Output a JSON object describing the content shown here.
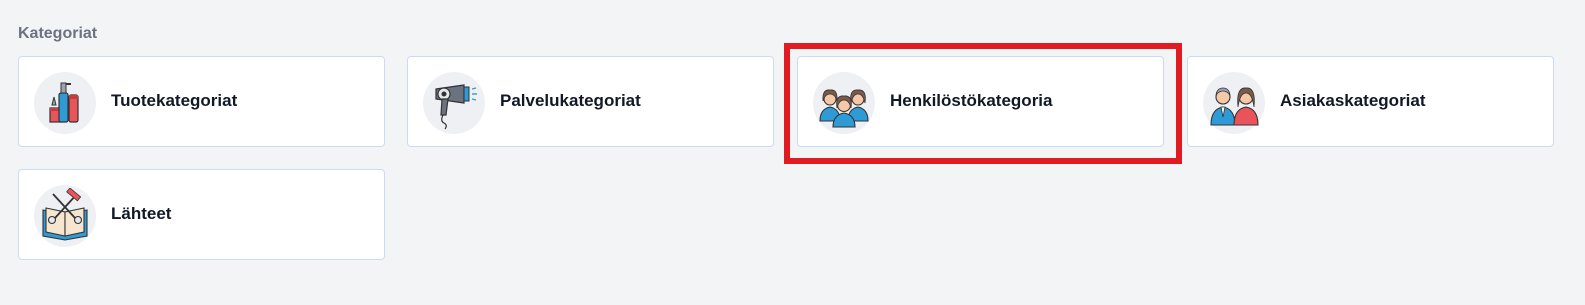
{
  "section": {
    "title": "Kategoriat"
  },
  "cards": [
    {
      "label": "Tuotekategoriat",
      "icon": "cosmetics-bottles-icon"
    },
    {
      "label": "Palvelukategoriat",
      "icon": "hair-dryer-icon"
    },
    {
      "label": "Henkilöstökategoria",
      "icon": "staff-group-icon"
    },
    {
      "label": "Asiakaskategoriat",
      "icon": "customers-couple-icon"
    },
    {
      "label": "Lähteet",
      "icon": "open-book-scissors-icon"
    }
  ],
  "highlight": {
    "color": "#e11b22",
    "target": "Henkilöstökategoria"
  },
  "colors": {
    "background": "#f3f4f6",
    "card_border": "#c9dcf3",
    "accent_blue": "#2e9bd6",
    "accent_red": "#e8545a"
  }
}
